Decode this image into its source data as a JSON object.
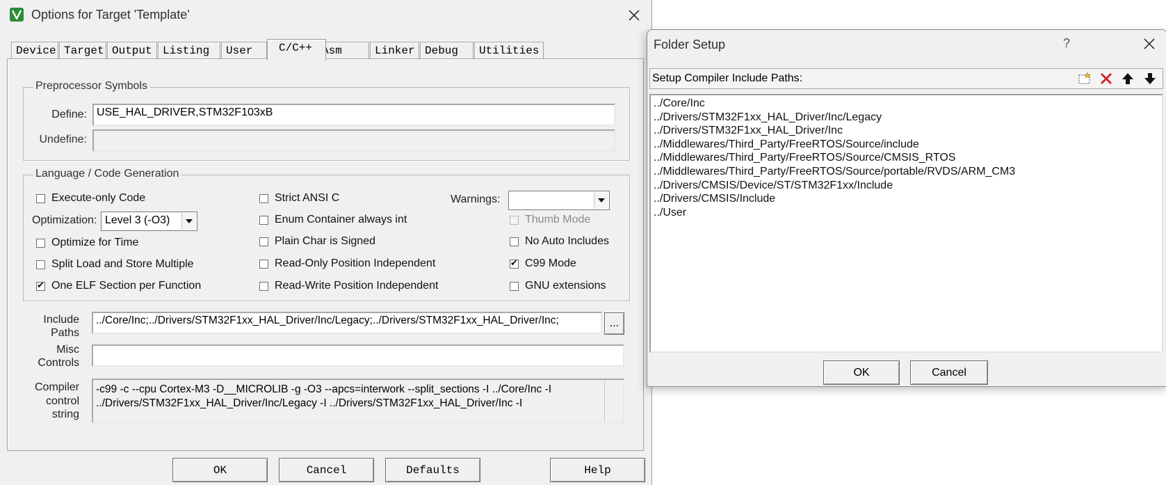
{
  "main_dialog": {
    "title": "Options for Target 'Template'",
    "tabs": [
      {
        "label": "Device"
      },
      {
        "label": "Target"
      },
      {
        "label": "Output"
      },
      {
        "label": "Listing"
      },
      {
        "label": "User"
      },
      {
        "label": "C/C++"
      },
      {
        "label": "Asm"
      },
      {
        "label": "Linker"
      },
      {
        "label": "Debug"
      },
      {
        "label": "Utilities"
      }
    ],
    "active_tab": "C/C++",
    "preprocessor": {
      "legend": "Preprocessor Symbols",
      "define_label": "Define:",
      "define_value": "USE_HAL_DRIVER,STM32F103xB",
      "undefine_label": "Undefine:",
      "undefine_value": ""
    },
    "language": {
      "legend": "Language / Code Generation",
      "execute_only": {
        "label": "Execute-only Code",
        "checked": false
      },
      "optimization_label": "Optimization:",
      "optimization_value": "Level 3 (-O3)",
      "optimize_time": {
        "label": "Optimize for Time",
        "checked": false
      },
      "split_load": {
        "label": "Split Load and Store Multiple",
        "checked": false
      },
      "one_elf": {
        "label": "One ELF Section per Function",
        "checked": true
      },
      "strict_ansi": {
        "label": "Strict ANSI C",
        "checked": false
      },
      "enum_container": {
        "label": "Enum Container always int",
        "checked": false
      },
      "plain_char": {
        "label": "Plain Char is Signed",
        "checked": false
      },
      "ro_pi": {
        "label": "Read-Only Position Independent",
        "checked": false
      },
      "rw_pi": {
        "label": "Read-Write Position Independent",
        "checked": false
      },
      "warnings_label": "Warnings:",
      "warnings_value": "",
      "thumb_mode": {
        "label": "Thumb Mode",
        "checked": false
      },
      "no_auto_includes": {
        "label": "No Auto Includes",
        "checked": false
      },
      "c99_mode": {
        "label": "C99 Mode",
        "checked": true
      },
      "gnu_extensions": {
        "label": "GNU extensions",
        "checked": false
      }
    },
    "include_paths": {
      "label_line1": "Include",
      "label_line2": "Paths",
      "value": "../Core/Inc;../Drivers/STM32F1xx_HAL_Driver/Inc/Legacy;../Drivers/STM32F1xx_HAL_Driver/Inc;",
      "browse_label": "..."
    },
    "misc_controls": {
      "label_line1": "Misc",
      "label_line2": "Controls",
      "value": ""
    },
    "compiler_control": {
      "label_line1": "Compiler",
      "label_line2": "control",
      "label_line3": "string",
      "line1": "-c99 -c --cpu Cortex-M3 -D__MICROLIB -g -O3 --apcs=interwork --split_sections -I ../Core/Inc -I",
      "line2": "../Drivers/STM32F1xx_HAL_Driver/Inc/Legacy -I ../Drivers/STM32F1xx_HAL_Driver/Inc -I"
    },
    "buttons": {
      "ok": "OK",
      "cancel": "Cancel",
      "defaults": "Defaults",
      "help": "Help"
    }
  },
  "folder_dialog": {
    "title": "Folder Setup",
    "help_glyph": "?",
    "toolbar_label": "Setup Compiler Include Paths:",
    "paths": [
      "../Core/Inc",
      "../Drivers/STM32F1xx_HAL_Driver/Inc/Legacy",
      "../Drivers/STM32F1xx_HAL_Driver/Inc",
      "../Middlewares/Third_Party/FreeRTOS/Source/include",
      "../Middlewares/Third_Party/FreeRTOS/Source/CMSIS_RTOS",
      "../Middlewares/Third_Party/FreeRTOS/Source/portable/RVDS/ARM_CM3",
      "../Drivers/CMSIS/Device/ST/STM32F1xx/Include",
      "../Drivers/CMSIS/Include",
      "../User"
    ],
    "buttons": {
      "ok": "OK",
      "cancel": "Cancel"
    }
  },
  "icons": {
    "app_icon": "keil-uvision-icon",
    "close": "close-icon",
    "new_folder": "new-folder-icon",
    "delete": "delete-icon",
    "move_up": "arrow-up-icon",
    "move_down": "arrow-down-icon",
    "dropdown": "chevron-down-icon"
  },
  "colors": {
    "dialog_bg": "#f0f0f0",
    "app_icon_green": "#2e8b3a",
    "delete_red": "#d02020"
  }
}
